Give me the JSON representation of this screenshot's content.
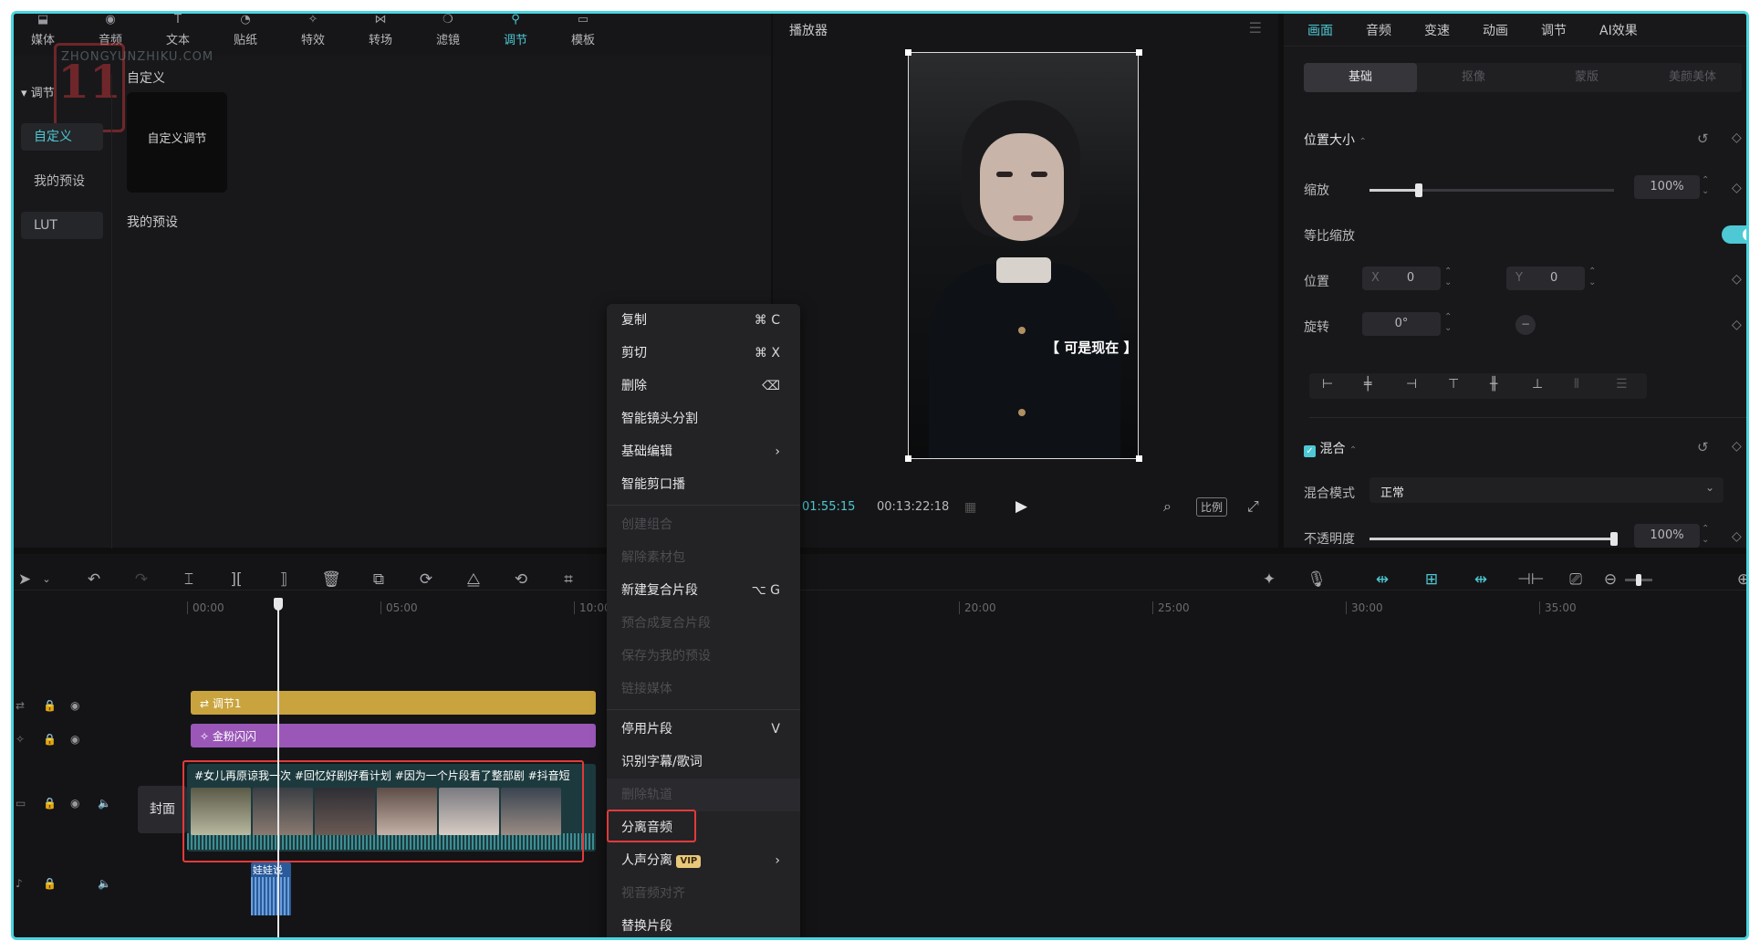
{
  "toolbar": {
    "items": [
      {
        "label": "媒体",
        "icon": "media-icon"
      },
      {
        "label": "音频",
        "icon": "audio-icon"
      },
      {
        "label": "文本",
        "icon": "text-icon"
      },
      {
        "label": "贴纸",
        "icon": "sticker-icon"
      },
      {
        "label": "特效",
        "icon": "effects-icon"
      },
      {
        "label": "转场",
        "icon": "transition-icon"
      },
      {
        "label": "滤镜",
        "icon": "filter-icon"
      },
      {
        "label": "调节",
        "icon": "adjust-icon"
      },
      {
        "label": "模板",
        "icon": "template-icon"
      }
    ],
    "active_index": 7
  },
  "watermark": {
    "logo_text": "11",
    "url_text": "ZHONGYUNZHIKU.COM"
  },
  "left_sidebar": {
    "group_label": "调节",
    "items": [
      "自定义",
      "我的预设",
      "LUT"
    ]
  },
  "library": {
    "section1_title": "自定义",
    "card_label": "自定义调节",
    "section2_title": "我的预设"
  },
  "player": {
    "title": "播放器",
    "caption": "【 可是现在 】",
    "current_time": "01:55:15",
    "total_time": "00:13:22:18",
    "ratio_label": "比例"
  },
  "right_panel": {
    "tabs": [
      "画面",
      "音频",
      "变速",
      "动画",
      "调节",
      "AI效果"
    ],
    "active_tab": 0,
    "subtabs": [
      "基础",
      "抠像",
      "蒙版",
      "美颜美体"
    ],
    "active_subtab": 0,
    "position_size_title": "位置大小",
    "scale_label": "缩放",
    "scale_value": "100%",
    "scale_level": 0.2,
    "uniform_label": "等比缩放",
    "position_label": "位置",
    "pos_x_label": "X",
    "pos_x_value": "0",
    "pos_y_label": "Y",
    "pos_y_value": "0",
    "rotate_label": "旋转",
    "rotate_value": "0°",
    "blend_title": "混合",
    "blend_mode_label": "混合模式",
    "blend_mode_value": "正常",
    "opacity_label": "不透明度",
    "opacity_value": "100%",
    "opacity_level": 1.0
  },
  "context_menu": {
    "items": [
      {
        "label": "复制",
        "shortcut": "⌘  C",
        "disabled": false
      },
      {
        "label": "剪切",
        "shortcut": "⌘  X",
        "disabled": false
      },
      {
        "label": "删除",
        "shortcut": "⌫",
        "disabled": false
      },
      {
        "label": "智能镜头分割",
        "shortcut": "",
        "disabled": false
      },
      {
        "label": "基础编辑",
        "shortcut": "›",
        "disabled": false
      },
      {
        "label": "智能剪口播",
        "shortcut": "",
        "disabled": false
      },
      {
        "label": "创建组合",
        "shortcut": "",
        "disabled": true
      },
      {
        "label": "解除素材包",
        "shortcut": "",
        "disabled": true
      },
      {
        "label": "新建复合片段",
        "shortcut": "⌥  G",
        "disabled": false
      },
      {
        "label": "预合成复合片段",
        "shortcut": "",
        "disabled": true
      },
      {
        "label": "保存为我的预设",
        "shortcut": "",
        "disabled": true
      },
      {
        "label": "链接媒体",
        "shortcut": "",
        "disabled": true
      },
      {
        "label": "停用片段",
        "shortcut": "V",
        "disabled": false
      },
      {
        "label": "识别字幕/歌词",
        "shortcut": "",
        "disabled": false
      },
      {
        "label": "删除轨道",
        "shortcut": "",
        "disabled": true
      },
      {
        "label": "分离音频",
        "shortcut": "",
        "disabled": false
      },
      {
        "label": "人声分离",
        "shortcut": "›",
        "disabled": false,
        "badge": "VIP"
      },
      {
        "label": "视音频对齐",
        "shortcut": "",
        "disabled": true
      },
      {
        "label": "替换片段",
        "shortcut": "",
        "disabled": false
      }
    ]
  },
  "timeline": {
    "ticks": [
      "00:00",
      "05:00",
      "10:00",
      "20:00",
      "25:00",
      "30:00",
      "35:00"
    ],
    "tracks": {
      "adjust_clip_label": "调节1",
      "effect_clip_label": "金粉闪闪",
      "video_clip_title": "#女儿再原谅我一次 #回忆好剧好看计划 #因为一个片段看了整部剧 #抖音短",
      "cover_label": "封面",
      "audio_clip_label": "娃娃说"
    }
  },
  "colors": {
    "accent": "#4ec8d4",
    "highlight_red": "#e23a3a",
    "adjust_track": "#c9a43e",
    "effect_track": "#9a57b8"
  }
}
